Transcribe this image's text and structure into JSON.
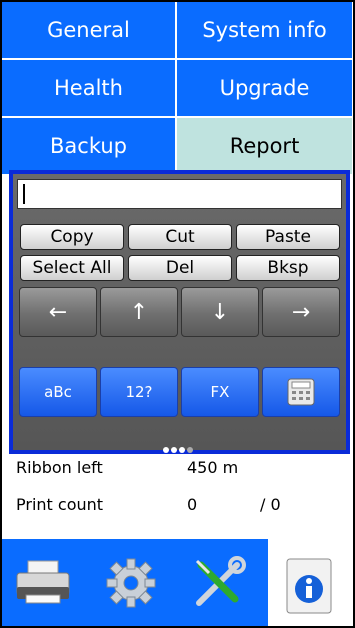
{
  "tabs": [
    {
      "label": "General",
      "active": false
    },
    {
      "label": "System info",
      "active": false
    },
    {
      "label": "Health",
      "active": false
    },
    {
      "label": "Upgrade",
      "active": false
    },
    {
      "label": "Backup",
      "active": false
    },
    {
      "label": "Report",
      "active": true
    }
  ],
  "info": {
    "ribbon_left_label": "Ribbon left",
    "ribbon_left_value": "450 m",
    "print_count_label": "Print count",
    "print_count_value": "0",
    "print_count_total": "/ 0"
  },
  "keyboard": {
    "input_value": "",
    "edit_keys": [
      "Copy",
      "Cut",
      "Paste",
      "Select All",
      "Del",
      "Bksp"
    ],
    "arrow_keys": [
      "←",
      "↑",
      "↓",
      "→"
    ],
    "mode_keys": [
      "aBc",
      "12?",
      "FX"
    ],
    "calculator_icon": "calculator-icon"
  },
  "bottom_icons": [
    "printer-icon",
    "gear-icon",
    "tools-icon",
    "info-icon"
  ],
  "colors": {
    "accent": "#0a6cff",
    "active_tab": "#bfe3df",
    "keyboard_border": "#0a2bd8"
  }
}
